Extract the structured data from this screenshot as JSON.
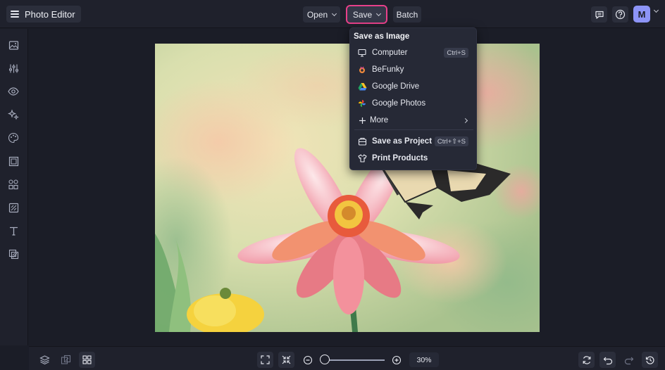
{
  "app": {
    "title": "Photo Editor"
  },
  "toolbar": {
    "open_label": "Open",
    "save_label": "Save",
    "batch_label": "Batch",
    "accent": "#e8408a"
  },
  "account": {
    "initial": "M",
    "color": "#8d94f7"
  },
  "sidebar": {
    "items": [
      {
        "icon": "image-icon"
      },
      {
        "icon": "adjustments-icon"
      },
      {
        "icon": "eye-icon"
      },
      {
        "icon": "effects-sparkle-icon"
      },
      {
        "icon": "artsy-palette-icon"
      },
      {
        "icon": "frame-icon"
      },
      {
        "icon": "graphics-icon"
      },
      {
        "icon": "overlay-icon"
      },
      {
        "icon": "text-icon"
      },
      {
        "icon": "textures-icon"
      }
    ]
  },
  "save_menu": {
    "header": "Save as Image",
    "items": [
      {
        "label": "Computer",
        "icon": "monitor-icon",
        "shortcut": "Ctrl+S"
      },
      {
        "label": "BeFunky",
        "icon": "befunky-logo-icon"
      },
      {
        "label": "Google Drive",
        "icon": "google-drive-icon"
      },
      {
        "label": "Google Photos",
        "icon": "google-photos-icon"
      },
      {
        "label": "More",
        "icon": "plus-icon"
      }
    ],
    "project_items": [
      {
        "label": "Save as Project",
        "icon": "project-box-icon",
        "shortcut": "Ctrl+⇧+S"
      },
      {
        "label": "Print Products",
        "icon": "tshirt-icon"
      }
    ]
  },
  "bottom": {
    "zoom_value": "30%",
    "zoom_level": 0.3
  }
}
